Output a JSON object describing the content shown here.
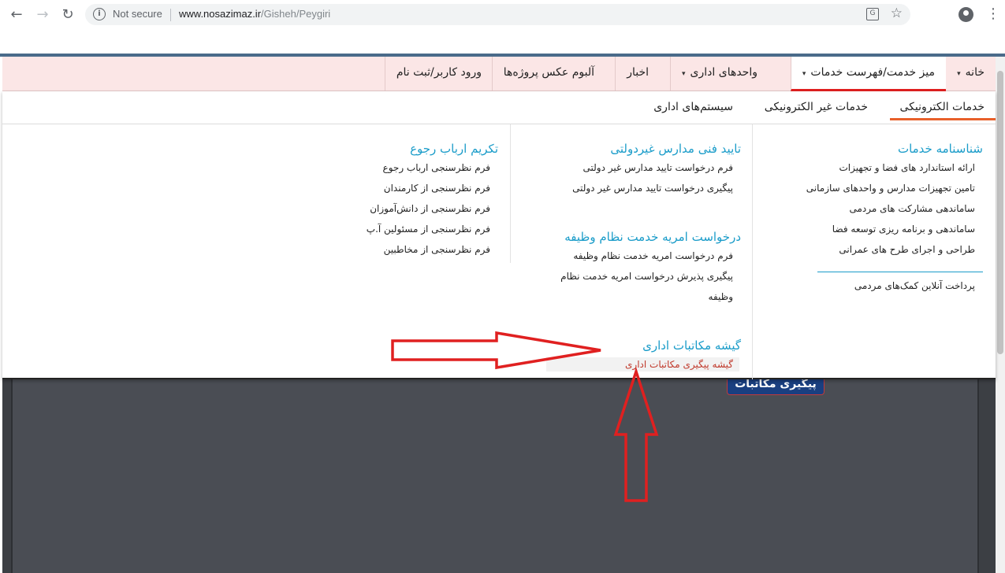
{
  "browser": {
    "security_status": "Not secure",
    "url_host": "www.nosazimaz.ir",
    "url_path": "/Gisheh/Peygiri",
    "back_glyph": "←",
    "forward_glyph": "→",
    "reload_glyph": "↻",
    "star_glyph": "☆",
    "menu_glyph": "⋮",
    "translate_glyph": "G",
    "info_glyph": "i"
  },
  "main_nav": {
    "items": [
      {
        "label": "خانه",
        "has_caret": true
      },
      {
        "label": "میز خدمت/فهرست خدمات",
        "has_caret": true,
        "active": true
      },
      {
        "label": "واحدهای اداری",
        "has_caret": true
      },
      {
        "label": "اخبار",
        "has_caret": false
      },
      {
        "label": "آلبوم عکس پروژه‌ها",
        "has_caret": false
      },
      {
        "label": "ورود کاربر/ثبت نام",
        "has_caret": false
      }
    ],
    "caret_glyph": "▾",
    "active_color": "#e02020"
  },
  "subtabs": [
    {
      "label": "خدمات الکترونیکی",
      "active": true
    },
    {
      "label": "خدمات غیر الکترونیکی"
    },
    {
      "label": "سیستم‌های اداری"
    }
  ],
  "columns": {
    "col1": {
      "title": "شناسنامه خدمات",
      "links": [
        "ارائه استاندارد های فضا و تجهیزات",
        "تامین تجهیزات مدارس و واحدهای سازمانی",
        "ساماندهی مشارکت های مردمی",
        "ساماندهی و برنامه ریزی توسعه فضا",
        "طراحی و اجرای طرح های عمرانی"
      ],
      "extra_link": "پرداخت آنلاین کمک‌های مردمی"
    },
    "col2": {
      "group1_title": "تایید فنی مدارس غیردولتی",
      "group1_links": [
        "فرم درخواست تایید مدارس غیر دولتی",
        "پیگیری درخواست تایید مدارس غیر دولتی"
      ],
      "group2_title": "درخواست امریه خدمت نظام وظیفه",
      "group2_links": [
        "فرم درخواست امریه خدمت نظام وظیفه",
        "پیگیری پذیرش درخواست امریه خدمت نظام",
        "وظیفه"
      ],
      "group3_title": "گیشه مکاتبات اداری",
      "group3_links": [
        "گیشه پیگیری مکاتبات اداری"
      ]
    },
    "col3": {
      "title": "تکریم ارباب رجوع",
      "links": [
        "فرم نظرسنجی ارباب رجوع",
        "فرم نظرسنجی از کارمندان",
        "فرم نظرسنجی از دانش‌آموزان",
        "فرم نظرسنجی از مسئولین آ.پ",
        "فرم نظرسنجی از مخاطبین"
      ]
    }
  },
  "background_button": "پیگیری مکاتبات",
  "colors": {
    "title_blue": "#1a9cc9",
    "nav_bg": "#fbe6e6",
    "highlight_link": "#c0392b",
    "annotation_arrow": "#e02020"
  }
}
